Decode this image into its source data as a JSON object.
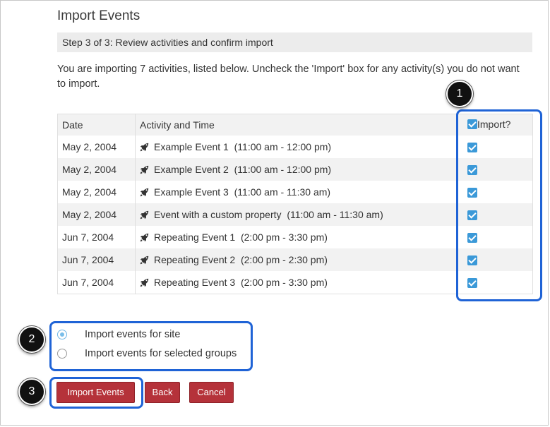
{
  "page": {
    "title": "Import Events",
    "step": "Step 3 of 3: Review activities and confirm import",
    "intro": "You are importing 7 activities, listed below. Uncheck the 'Import' box for any activity(s) you do not want to import."
  },
  "table": {
    "headers": {
      "date": "Date",
      "activity": "Activity and Time",
      "import": "Import?"
    },
    "rows": [
      {
        "date": "May 2, 2004",
        "activity": "Example Event 1",
        "time": "(11:00 am - 12:00 pm)",
        "checked": true
      },
      {
        "date": "May 2, 2004",
        "activity": "Example Event 2",
        "time": "(11:00 am - 12:00 pm)",
        "checked": true
      },
      {
        "date": "May 2, 2004",
        "activity": "Example Event 3",
        "time": "(11:00 am - 11:30 am)",
        "checked": true
      },
      {
        "date": "May 2, 2004",
        "activity": "Event with a custom property",
        "time": "(11:00 am - 11:30 am)",
        "checked": true
      },
      {
        "date": "Jun 7, 2004",
        "activity": "Repeating Event 1",
        "time": "(2:00 pm - 3:30 pm)",
        "checked": true
      },
      {
        "date": "Jun 7, 2004",
        "activity": "Repeating Event 2",
        "time": "(2:00 pm - 2:30 pm)",
        "checked": true
      },
      {
        "date": "Jun 7, 2004",
        "activity": "Repeating Event 3",
        "time": "(2:00 pm - 3:30 pm)",
        "checked": true
      }
    ]
  },
  "options": {
    "site": {
      "label": "Import events for site",
      "selected": true
    },
    "groups": {
      "label": "Import events for selected groups",
      "selected": false
    }
  },
  "buttons": {
    "import": "Import Events",
    "back": "Back",
    "cancel": "Cancel"
  },
  "callouts": {
    "one": "1",
    "two": "2",
    "three": "3"
  },
  "colors": {
    "button": "#b5323a",
    "callout": "#1f63d6",
    "checkbox": "#3b99d8"
  },
  "icons": {
    "activity": "rocket-icon"
  }
}
